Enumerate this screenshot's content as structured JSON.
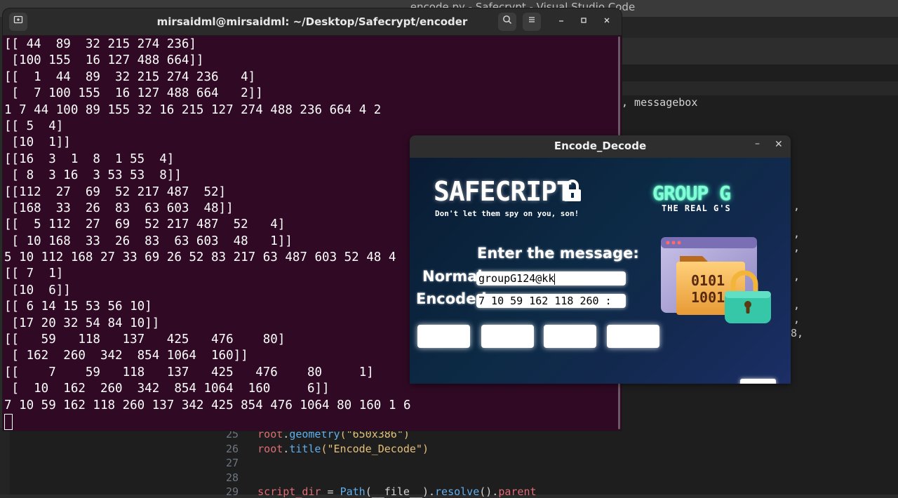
{
  "vscode": {
    "window_title": "encode.py - Safecrypt - Visual Studio Code",
    "fragments": [
      ", messagebox",
      ",",
      ",",
      ",",
      ",",
      ",",
      ",",
      "8,"
    ],
    "code_lines": [
      {
        "num": "25",
        "parts": [
          {
            "t": "root",
            "c": "var"
          },
          {
            "t": ".",
            "c": "plain"
          },
          {
            "t": "geometry",
            "c": "fn"
          },
          {
            "t": "(\"650x386\")",
            "c": "str"
          }
        ]
      },
      {
        "num": "26",
        "parts": [
          {
            "t": "root",
            "c": "var"
          },
          {
            "t": ".",
            "c": "plain"
          },
          {
            "t": "title",
            "c": "fn"
          },
          {
            "t": "(\"Encode_Decode\")",
            "c": "str"
          }
        ]
      },
      {
        "num": "27",
        "parts": []
      },
      {
        "num": "28",
        "parts": []
      },
      {
        "num": "29",
        "parts": [
          {
            "t": "script_dir",
            "c": "var"
          },
          {
            "t": " = ",
            "c": "plain"
          },
          {
            "t": "Path",
            "c": "fn"
          },
          {
            "t": "(__file__).",
            "c": "plain"
          },
          {
            "t": "resolve",
            "c": "fn"
          },
          {
            "t": "().",
            "c": "plain"
          },
          {
            "t": "parent",
            "c": "var"
          }
        ]
      }
    ]
  },
  "terminal": {
    "title": "mirsaidml@mirsaidml: ~/Desktop/Safecrypt/encoder",
    "lines": [
      "[[ 44  89  32 215 274 236]",
      " [100 155  16 127 488 664]]",
      "[[  1  44  89  32 215 274 236   4]",
      " [  7 100 155  16 127 488 664   2]]",
      "1 7 44 100 89 155 32 16 215 127 274 488 236 664 4 2",
      "[[ 5  4]",
      " [10  1]]",
      "[[16  3  1  8  1 55  4]",
      " [ 8  3 16  3 53 53  8]]",
      "[[112  27  69  52 217 487  52]",
      " [168  33  26  83  63 603  48]]",
      "[[  5 112  27  69  52 217 487  52   4]",
      " [ 10 168  33  26  83  63 603  48   1]]",
      "5 10 112 168 27 33 69 26 52 83 217 63 487 603 52 48 4",
      "[[ 7  1]",
      " [10  6]]",
      "[[ 6 14 15 53 56 10]",
      " [17 20 32 54 84 10]]",
      "[[   59   118   137   425   476    80]",
      " [ 162  260  342  854 1064  160]]",
      "[[    7    59   118   137   425   476    80     1]",
      " [  10  162  260  342  854 1064  160     6]]",
      "7 10 59 162 118 260 137 342 425 854 476 1064 80 160 1 6"
    ]
  },
  "app": {
    "title": "Encode_Decode",
    "brand": "SAFECRIPT",
    "tagline": "Don't let them spy on you, son!",
    "group_title": "GROUP G",
    "group_subtitle": "THE REAL G'S",
    "prompt": "Enter the message:",
    "normal_label": "Normal",
    "encoded_label": "Encoded",
    "normal_value": "groupG124@kk",
    "encoded_value": "7 10 59 162 118 260 :",
    "illustration_text": [
      "0101",
      "1001"
    ]
  }
}
